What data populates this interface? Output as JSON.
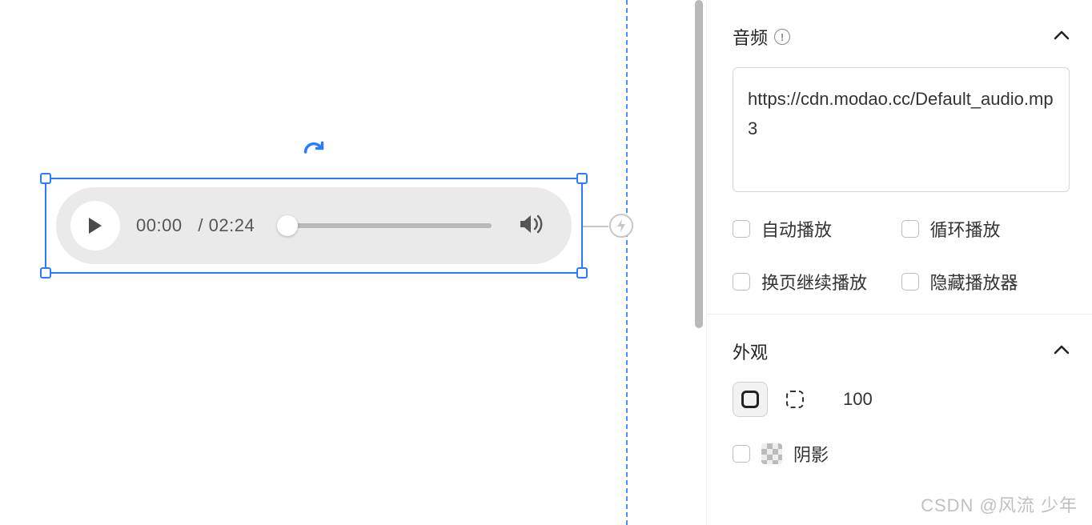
{
  "canvas": {
    "audio": {
      "current_time": "00:00",
      "duration": "02:24",
      "separator": "/"
    }
  },
  "panel": {
    "audio_section": {
      "title": "音频",
      "url": "https://cdn.modao.cc/Default_audio.mp3",
      "options": {
        "autoplay": "自动播放",
        "loop": "循环播放",
        "continue_on_page": "换页继续播放",
        "hide_player": "隐藏播放器"
      }
    },
    "appearance_section": {
      "title": "外观",
      "opacity": "100",
      "shadow_label": "阴影"
    }
  },
  "watermark": "CSDN @风流 少年"
}
